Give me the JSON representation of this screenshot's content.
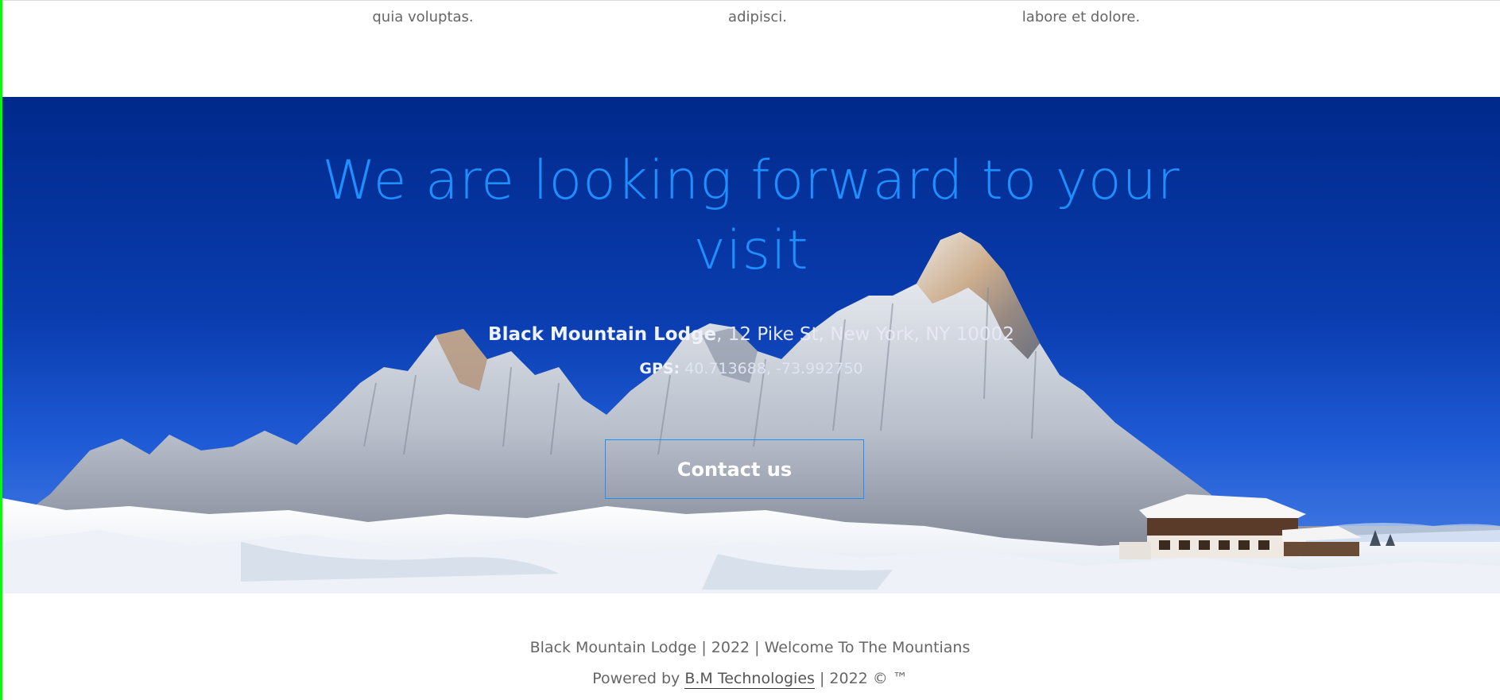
{
  "features": {
    "captions": [
      "quia voluptas.",
      "adipisci.",
      "labore et dolore."
    ]
  },
  "hero": {
    "title_line1": "We are looking forward to your",
    "title_line2": "visit",
    "lodge_name": "Black Mountain Lodge",
    "address": ", 12 Pike St, New York, NY 10002",
    "gps_label": "GPS:",
    "gps_value": "40.713688, -73.992750",
    "contact_label": "Contact us",
    "colors": {
      "title": "#1e8fff",
      "sky_top": "#00298a",
      "button_border": "#1e8fff"
    }
  },
  "footer": {
    "line1": "Black Mountain Lodge | 2022 | Welcome To The Mountians",
    "powered_prefix": "Powered by ",
    "powered_link": "B.M Technologies",
    "powered_suffix": " | 2022 © ™"
  }
}
